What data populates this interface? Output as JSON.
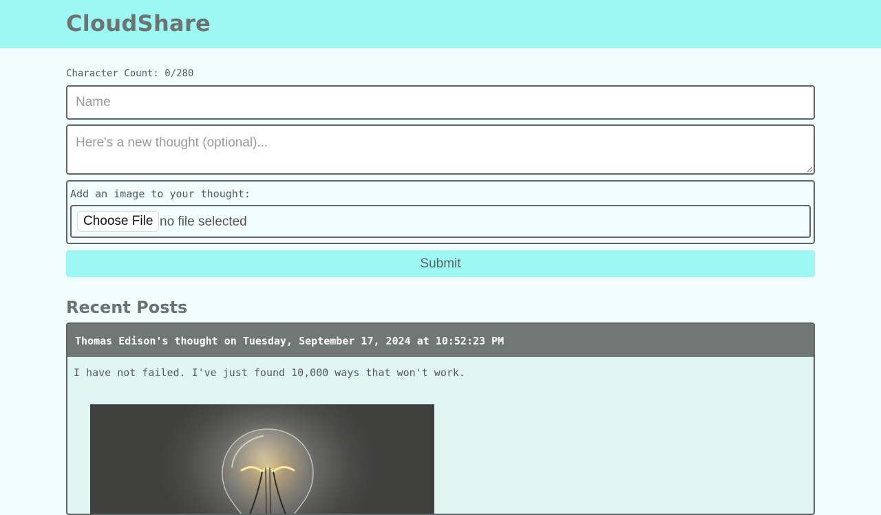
{
  "header": {
    "brand": "CloudShare"
  },
  "form": {
    "char_count": "Character Count: 0/280",
    "name_placeholder": "Name",
    "thought_placeholder": "Here's a new thought (optional)...",
    "image_label": "Add an image to your thought:",
    "choose_file_label": "Choose File",
    "file_status": "no file selected",
    "submit_label": "Submit"
  },
  "recent": {
    "title": "Recent Posts",
    "posts": [
      {
        "header": "Thomas Edison's thought on Tuesday, September 17, 2024 at 10:52:23 PM",
        "body": "I have not failed. I've just found 10,000 ways that won't work.",
        "image_icon": "light-bulb-photo"
      }
    ]
  },
  "colors": {
    "accent": "#9df7f2",
    "page_bg": "#f1fdfd",
    "border": "#5d6664",
    "card_header": "#6f7875",
    "card_bg": "#e1f5f3"
  }
}
